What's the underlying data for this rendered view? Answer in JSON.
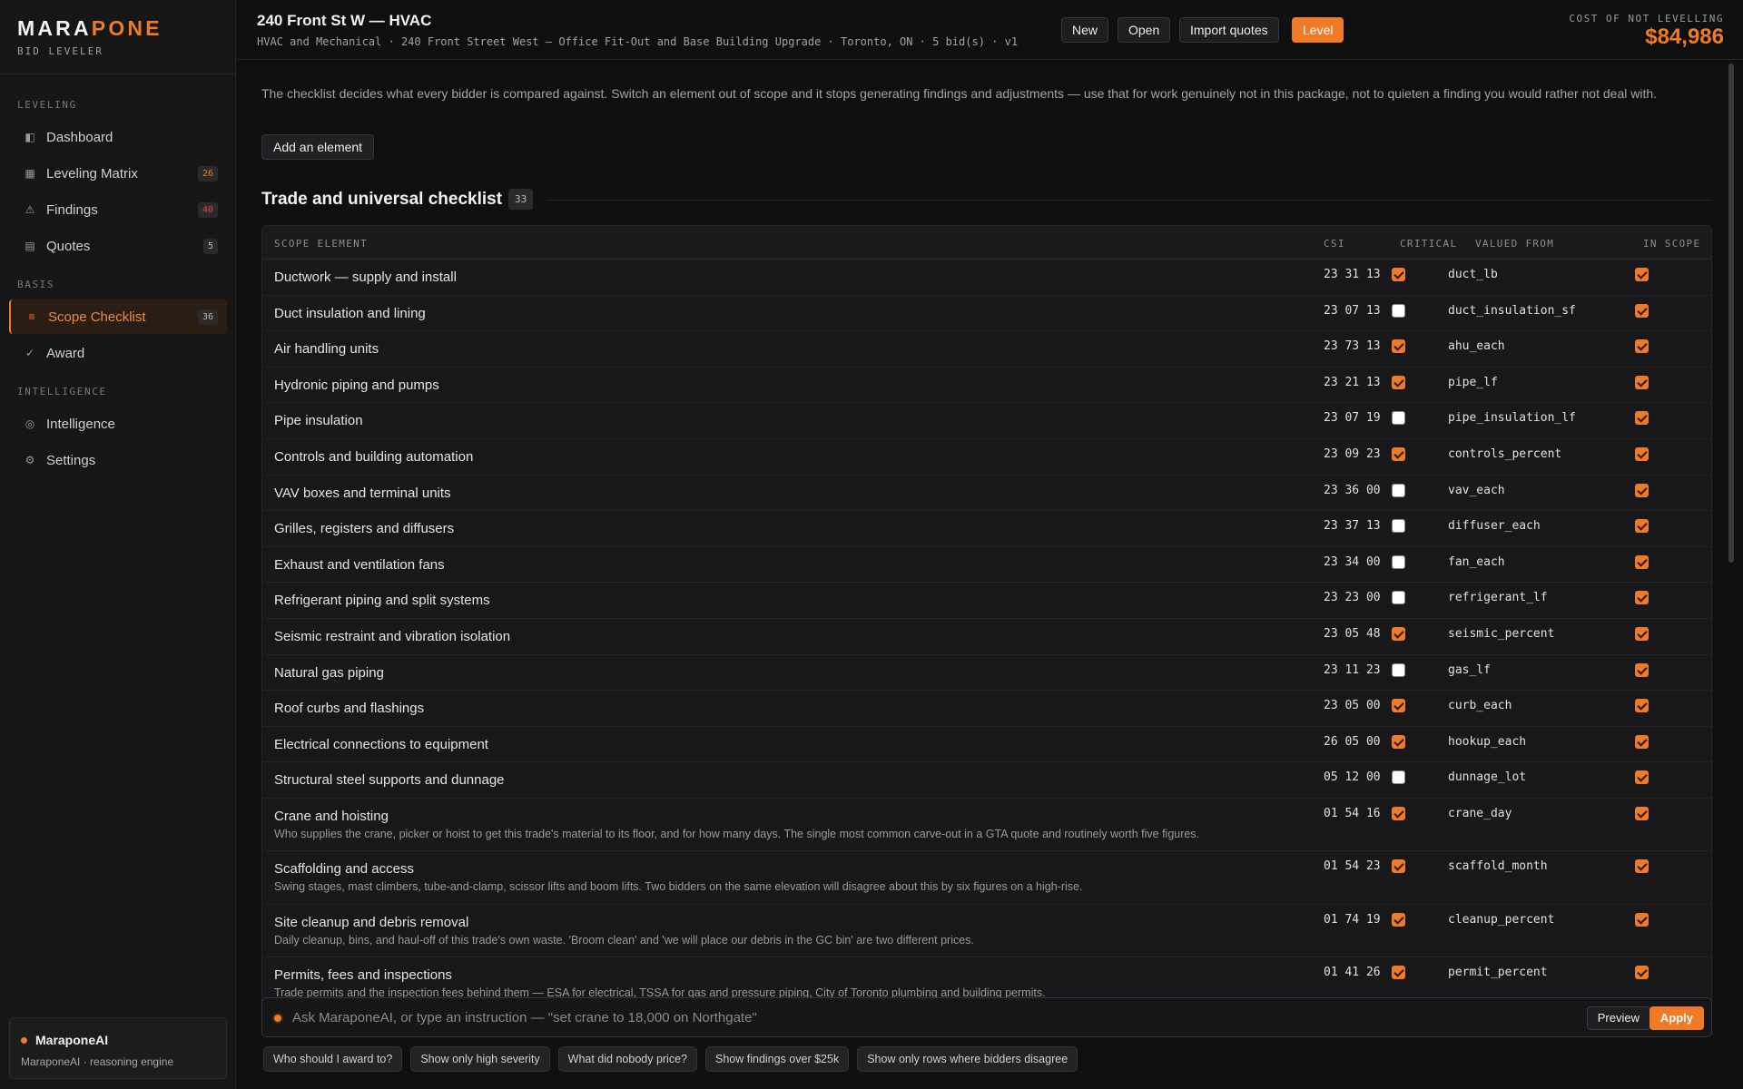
{
  "brand": {
    "name_a": "MARA",
    "name_b": "PONE",
    "subtitle": "BID LEVELER"
  },
  "sidebar": {
    "sections": {
      "leveling": "LEVELING",
      "basis": "BASIS",
      "intelligence": "INTELLIGENCE"
    },
    "items": [
      {
        "label": "Dashboard",
        "icon": "dashboard-icon",
        "badge": ""
      },
      {
        "label": "Leveling Matrix",
        "icon": "grid-icon",
        "badge": "26",
        "badge_color": "#f07b27"
      },
      {
        "label": "Findings",
        "icon": "warning-icon",
        "badge": "40",
        "badge_color": "#e0463c"
      },
      {
        "label": "Quotes",
        "icon": "document-icon",
        "badge": "5"
      },
      {
        "label": "Scope Checklist",
        "icon": "list-icon",
        "badge": "36",
        "active": true
      },
      {
        "label": "Award",
        "icon": "check-icon",
        "badge": ""
      },
      {
        "label": "Intelligence",
        "icon": "target-icon",
        "badge": ""
      },
      {
        "label": "Settings",
        "icon": "gear-icon",
        "badge": ""
      }
    ],
    "ai": {
      "title": "MaraponeAI",
      "subtitle": "MaraponeAI · reasoning engine"
    }
  },
  "header": {
    "title": "240 Front St W — HVAC",
    "subtitle": "HVAC and Mechanical · 240 Front Street West — Office Fit-Out and Base Building Upgrade · Toronto, ON · 5 bid(s) · v1",
    "buttons": {
      "new": "New",
      "open": "Open",
      "import": "Import quotes",
      "level": "Level"
    },
    "cost_label": "COST OF NOT LEVELLING",
    "cost_value": "$84,986"
  },
  "main": {
    "intro": "The checklist decides what every bidder is compared against. Switch an element out of scope and it stops generating findings and adjustments — use that for work genuinely not in this package, not to quieten a finding you would rather not deal with.",
    "add_button": "Add an element",
    "section_title": "Trade and universal checklist",
    "section_count": "33",
    "columns": {
      "element": "SCOPE ELEMENT",
      "csi": "CSI",
      "critical": "CRITICAL",
      "valued_from": "VALUED FROM",
      "in_scope": "IN SCOPE"
    },
    "rows": [
      {
        "name": "Ductwork — supply and install",
        "csi": "23 31 13",
        "critical": true,
        "valued_from": "duct_lb",
        "in_scope": true,
        "note": ""
      },
      {
        "name": "Duct insulation and lining",
        "csi": "23 07 13",
        "critical": false,
        "valued_from": "duct_insulation_sf",
        "in_scope": true,
        "note": ""
      },
      {
        "name": "Air handling units",
        "csi": "23 73 13",
        "critical": true,
        "valued_from": "ahu_each",
        "in_scope": true,
        "note": ""
      },
      {
        "name": "Hydronic piping and pumps",
        "csi": "23 21 13",
        "critical": true,
        "valued_from": "pipe_lf",
        "in_scope": true,
        "note": ""
      },
      {
        "name": "Pipe insulation",
        "csi": "23 07 19",
        "critical": false,
        "valued_from": "pipe_insulation_lf",
        "in_scope": true,
        "note": ""
      },
      {
        "name": "Controls and building automation",
        "csi": "23 09 23",
        "critical": true,
        "valued_from": "controls_percent",
        "in_scope": true,
        "note": ""
      },
      {
        "name": "VAV boxes and terminal units",
        "csi": "23 36 00",
        "critical": false,
        "valued_from": "vav_each",
        "in_scope": true,
        "note": ""
      },
      {
        "name": "Grilles, registers and diffusers",
        "csi": "23 37 13",
        "critical": false,
        "valued_from": "diffuser_each",
        "in_scope": true,
        "note": ""
      },
      {
        "name": "Exhaust and ventilation fans",
        "csi": "23 34 00",
        "critical": false,
        "valued_from": "fan_each",
        "in_scope": true,
        "note": ""
      },
      {
        "name": "Refrigerant piping and split systems",
        "csi": "23 23 00",
        "critical": false,
        "valued_from": "refrigerant_lf",
        "in_scope": true,
        "note": ""
      },
      {
        "name": "Seismic restraint and vibration isolation",
        "csi": "23 05 48",
        "critical": true,
        "valued_from": "seismic_percent",
        "in_scope": true,
        "note": ""
      },
      {
        "name": "Natural gas piping",
        "csi": "23 11 23",
        "critical": false,
        "valued_from": "gas_lf",
        "in_scope": true,
        "note": ""
      },
      {
        "name": "Roof curbs and flashings",
        "csi": "23 05 00",
        "critical": true,
        "valued_from": "curb_each",
        "in_scope": true,
        "note": ""
      },
      {
        "name": "Electrical connections to equipment",
        "csi": "26 05 00",
        "critical": true,
        "valued_from": "hookup_each",
        "in_scope": true,
        "note": ""
      },
      {
        "name": "Structural steel supports and dunnage",
        "csi": "05 12 00",
        "critical": false,
        "valued_from": "dunnage_lot",
        "in_scope": true,
        "note": ""
      },
      {
        "name": "Crane and hoisting",
        "csi": "01 54 16",
        "critical": true,
        "valued_from": "crane_day",
        "in_scope": true,
        "note": "Who supplies the crane, picker or hoist to get this trade's material to its floor, and for how many days. The single most common carve-out in a GTA quote and routinely worth five figures."
      },
      {
        "name": "Scaffolding and access",
        "csi": "01 54 23",
        "critical": true,
        "valued_from": "scaffold_month",
        "in_scope": true,
        "note": "Swing stages, mast climbers, tube-and-clamp, scissor lifts and boom lifts. Two bidders on the same elevation will disagree about this by six figures on a high-rise."
      },
      {
        "name": "Site cleanup and debris removal",
        "csi": "01 74 19",
        "critical": true,
        "valued_from": "cleanup_percent",
        "in_scope": true,
        "note": "Daily cleanup, bins, and haul-off of this trade's own waste. 'Broom clean' and 'we will place our debris in the GC bin' are two different prices."
      },
      {
        "name": "Permits, fees and inspections",
        "csi": "01 41 26",
        "critical": true,
        "valued_from": "permit_percent",
        "in_scope": true,
        "note": "Trade permits and the inspection fees behind them — ESA for electrical, TSSA for gas and pressure piping, City of Toronto plumbing and building permits."
      }
    ]
  },
  "command": {
    "placeholder": "Ask MaraponeAI, or type an instruction — \"set crane to 18,000 on Northgate\"",
    "preview": "Preview",
    "apply": "Apply",
    "chips": [
      "Who should I award to?",
      "Show only high severity",
      "What did nobody price?",
      "Show findings over $25k",
      "Show only rows where bidders disagree"
    ]
  },
  "colors": {
    "accent": "#f07b27",
    "danger": "#e0463c",
    "background": "#0f0f10"
  }
}
